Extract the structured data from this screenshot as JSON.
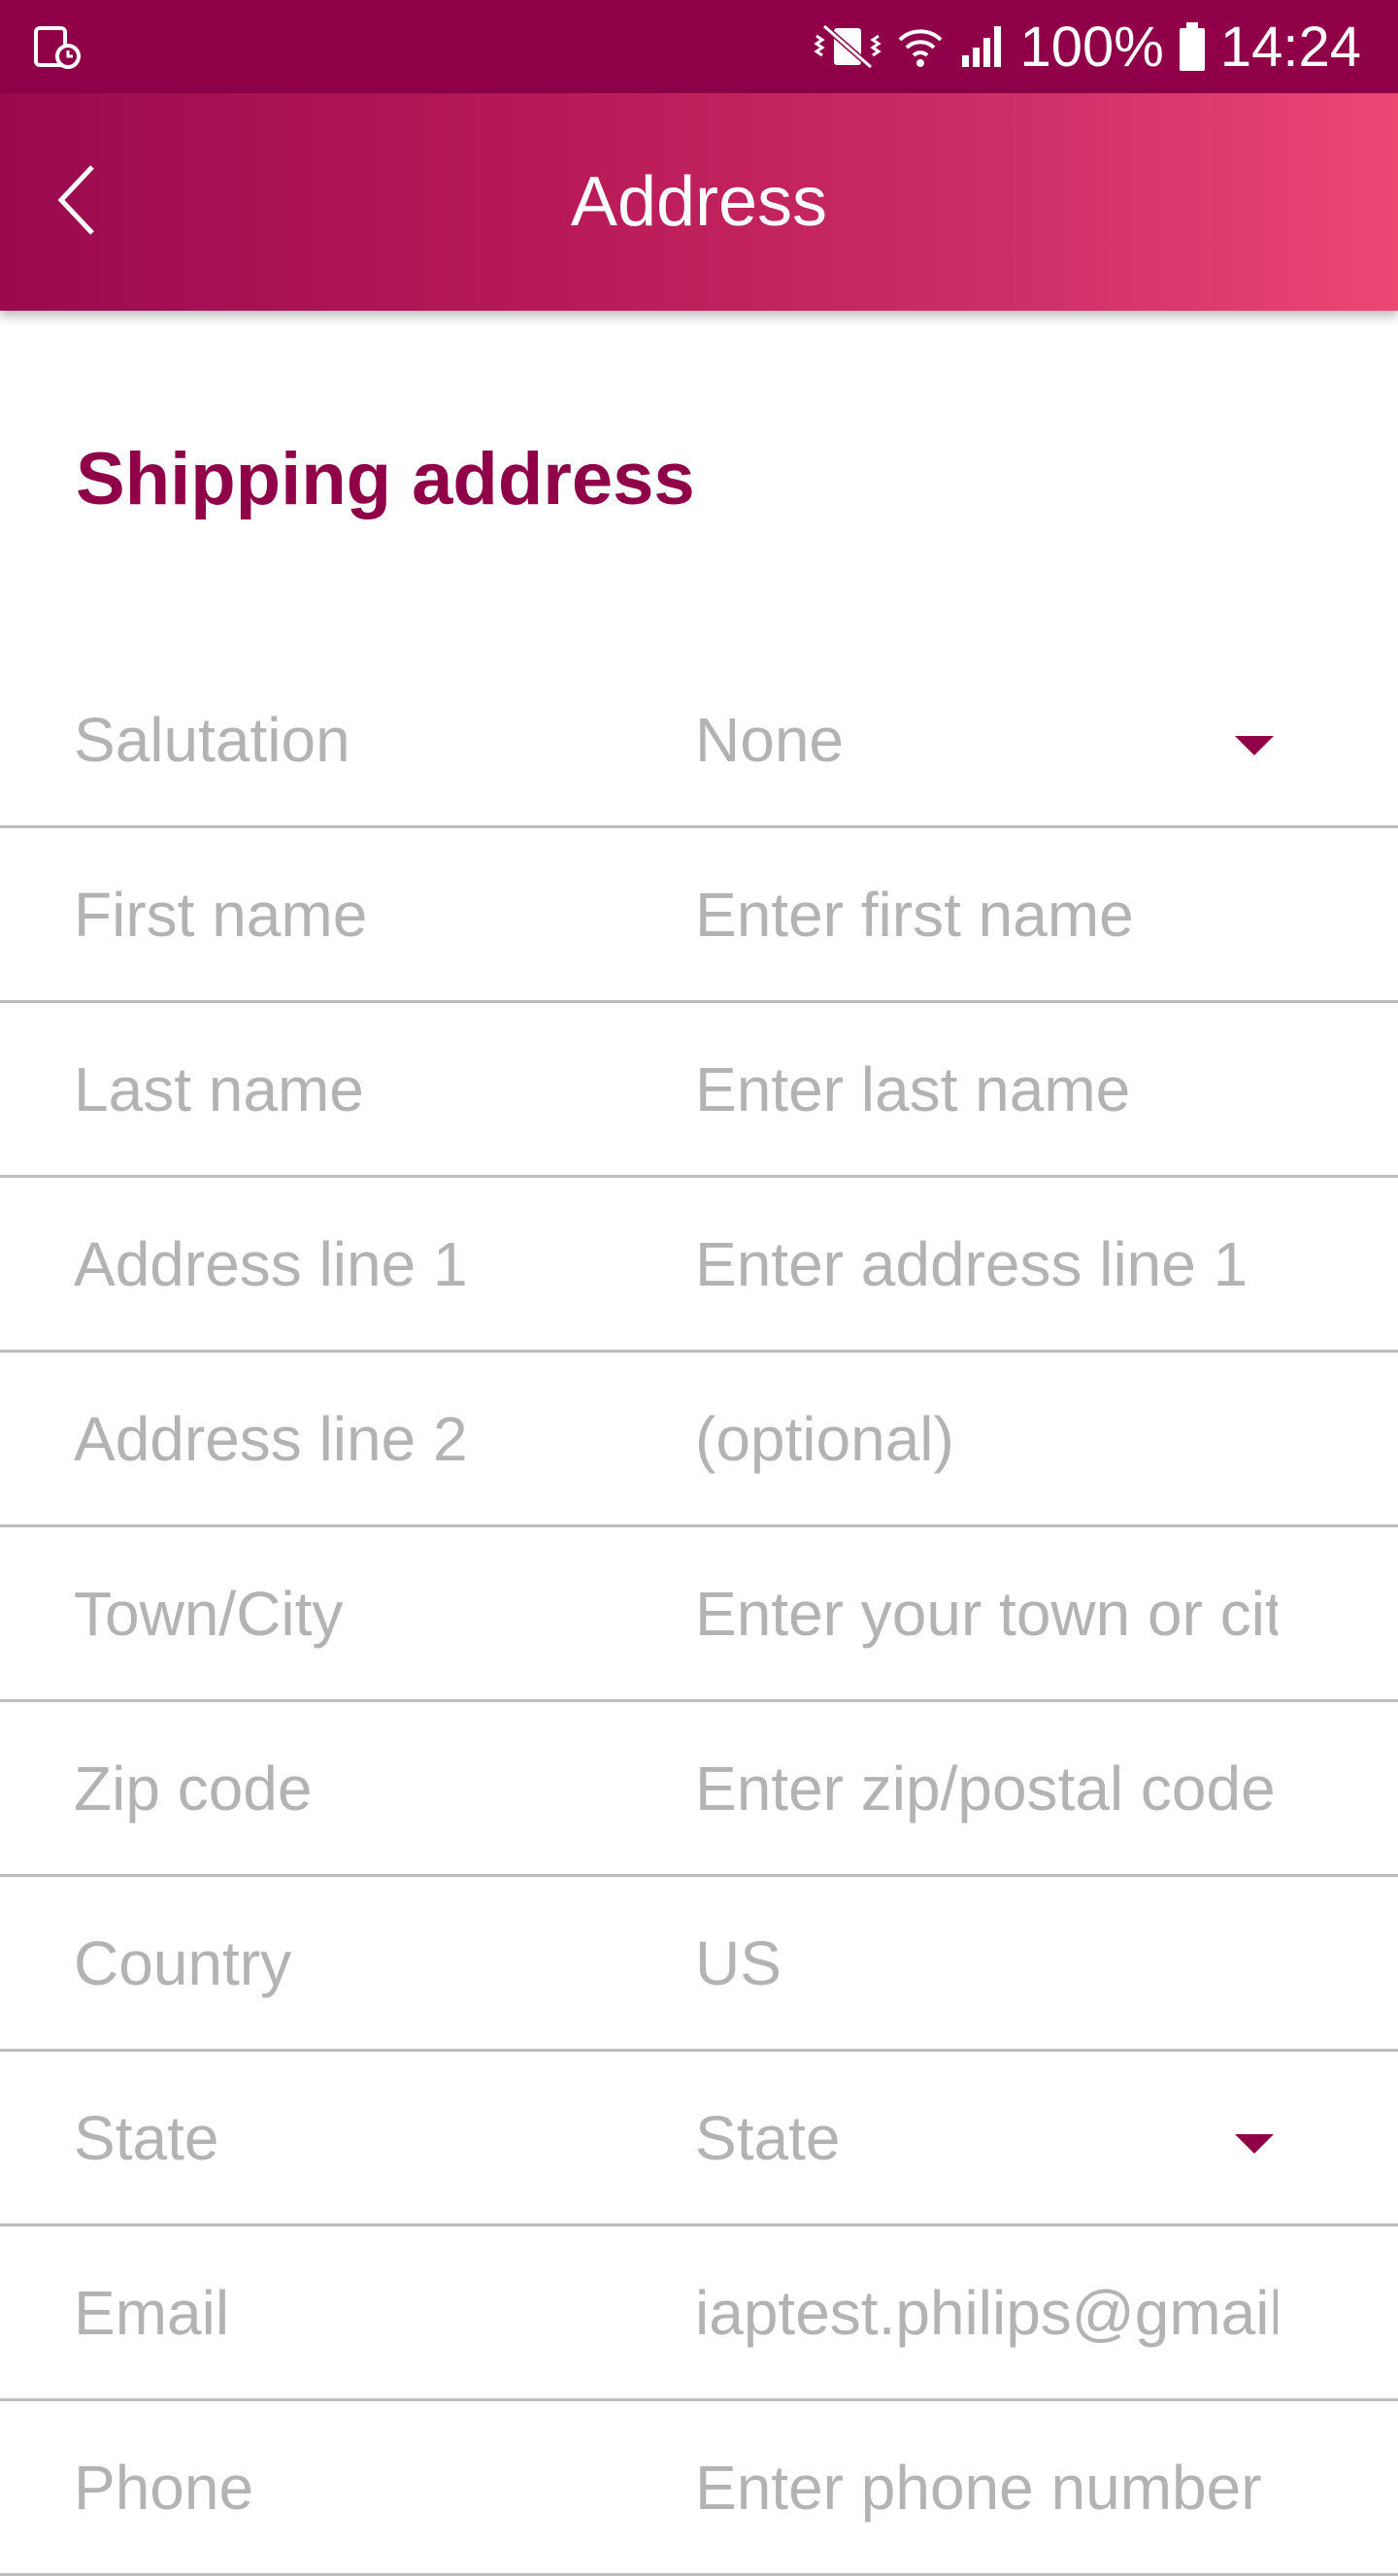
{
  "status_bar": {
    "battery": "100%",
    "time": "14:24",
    "icons": [
      "screenshot-notification-icon",
      "vibrate-icon",
      "wifi-icon",
      "signal-icon",
      "battery-icon"
    ]
  },
  "app_bar": {
    "title": "Address",
    "back_icon": "chevron-left-icon",
    "gradient": [
      "#9a0a4f",
      "#ec4673"
    ]
  },
  "section": {
    "title": "Shipping address",
    "accent_color": "#8f0048"
  },
  "form": {
    "rows": [
      {
        "label": "Salutation",
        "value": "None",
        "type": "select"
      },
      {
        "label": "First name",
        "placeholder": "Enter first name",
        "type": "input"
      },
      {
        "label": "Last name",
        "placeholder": "Enter last name",
        "type": "input"
      },
      {
        "label": "Address line 1",
        "placeholder": "Enter address line 1",
        "type": "input"
      },
      {
        "label": "Address line 2",
        "placeholder": "(optional)",
        "type": "input"
      },
      {
        "label": "Town/City",
        "placeholder": "Enter your town or city",
        "type": "input"
      },
      {
        "label": "Zip code",
        "placeholder": "Enter zip/postal code",
        "type": "input"
      },
      {
        "label": "Country",
        "value": "US",
        "type": "text"
      },
      {
        "label": "State",
        "value": "State",
        "type": "select"
      },
      {
        "label": "Email",
        "value": "iaptest.philips@gmail.com",
        "type": "input"
      },
      {
        "label": "Phone",
        "placeholder": "Enter phone number",
        "type": "input"
      }
    ]
  }
}
